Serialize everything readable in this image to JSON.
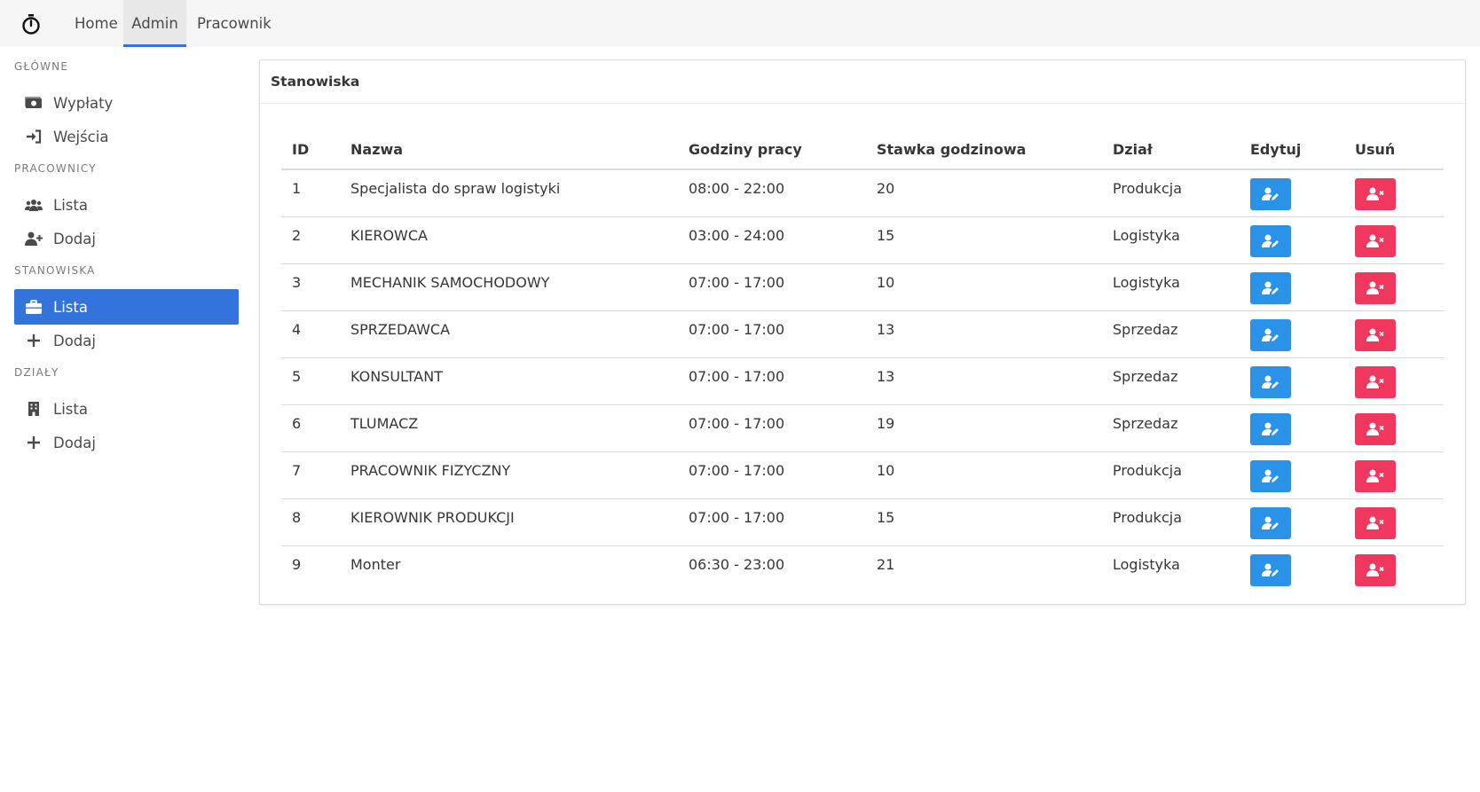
{
  "colors": {
    "accent": "#3273dc",
    "edit_button": "#2a93e8",
    "delete_button": "#f0385e"
  },
  "navbar": {
    "brand_icon": "stopwatch-icon",
    "items": [
      {
        "label": "Home"
      },
      {
        "label": "Admin",
        "active": true
      },
      {
        "label": "Pracownik"
      }
    ]
  },
  "sidebar": {
    "sections": [
      {
        "label": "GŁÓWNE",
        "items": [
          {
            "label": "Wypłaty",
            "icon": "money-icon"
          },
          {
            "label": "Wejścia",
            "icon": "sign-in-icon"
          }
        ]
      },
      {
        "label": "PRACOWNICY",
        "items": [
          {
            "label": "Lista",
            "icon": "users-icon"
          },
          {
            "label": "Dodaj",
            "icon": "user-plus-icon"
          }
        ]
      },
      {
        "label": "STANOWISKA",
        "items": [
          {
            "label": "Lista",
            "icon": "briefcase-icon",
            "active": true
          },
          {
            "label": "Dodaj",
            "icon": "plus-icon"
          }
        ]
      },
      {
        "label": "DZIAŁY",
        "items": [
          {
            "label": "Lista",
            "icon": "building-icon"
          },
          {
            "label": "Dodaj",
            "icon": "plus-icon"
          }
        ]
      }
    ]
  },
  "card": {
    "title": "Stanowiska",
    "columns": [
      "ID",
      "Nazwa",
      "Godziny pracy",
      "Stawka godzinowa",
      "Dział",
      "Edytuj",
      "Usuń"
    ],
    "rows": [
      {
        "id": "1",
        "name": "Specjalista do spraw logistyki",
        "hours": "08:00 - 22:00",
        "rate": "20",
        "dept": "Produkcja"
      },
      {
        "id": "2",
        "name": "KIEROWCA",
        "hours": "03:00 - 24:00",
        "rate": "15",
        "dept": "Logistyka"
      },
      {
        "id": "3",
        "name": "MECHANIK SAMOCHODOWY",
        "hours": "07:00 - 17:00",
        "rate": "10",
        "dept": "Logistyka"
      },
      {
        "id": "4",
        "name": "SPRZEDAWCA",
        "hours": "07:00 - 17:00",
        "rate": "13",
        "dept": "Sprzedaz"
      },
      {
        "id": "5",
        "name": "KONSULTANT",
        "hours": "07:00 - 17:00",
        "rate": "13",
        "dept": "Sprzedaz"
      },
      {
        "id": "6",
        "name": "TLUMACZ",
        "hours": "07:00 - 17:00",
        "rate": "19",
        "dept": "Sprzedaz"
      },
      {
        "id": "7",
        "name": "PRACOWNIK FIZYCZNY",
        "hours": "07:00 - 17:00",
        "rate": "10",
        "dept": "Produkcja"
      },
      {
        "id": "8",
        "name": "KIEROWNIK PRODUKCJI",
        "hours": "07:00 - 17:00",
        "rate": "15",
        "dept": "Produkcja"
      },
      {
        "id": "9",
        "name": "Monter",
        "hours": "06:30 - 23:00",
        "rate": "21",
        "dept": "Logistyka"
      }
    ]
  }
}
